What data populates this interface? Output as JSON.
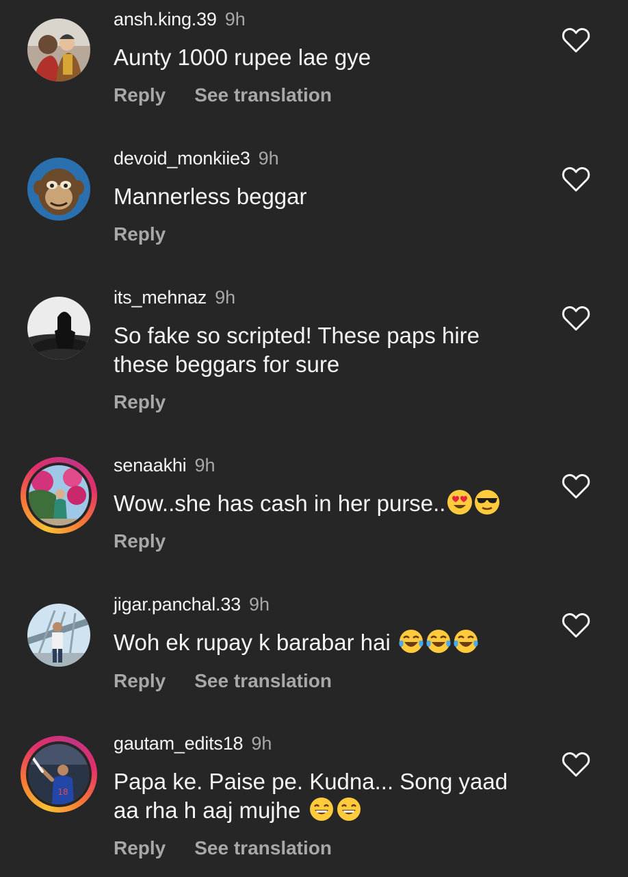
{
  "comments": [
    {
      "username": "ansh.king.39",
      "time": "9h",
      "text": "Aunty 1000 rupee lae gye",
      "reply_label": "Reply",
      "translate_label": "See translation",
      "avatar_icon": "profile-photo-icon",
      "emojis": []
    },
    {
      "username": "devoid_monkiie3",
      "time": "9h",
      "text": "Mannerless beggar",
      "reply_label": "Reply",
      "avatar_icon": "monkey-avatar-icon",
      "emojis": []
    },
    {
      "username": "its_mehnaz",
      "time": "9h",
      "text": "So fake so scripted! These paps hire these beggars for sure",
      "reply_label": "Reply",
      "avatar_icon": "profile-photo-icon",
      "emojis": []
    },
    {
      "username": "senaakhi",
      "time": "9h",
      "text": "Wow..she has cash in her purse..",
      "reply_label": "Reply",
      "avatar_icon": "profile-photo-icon",
      "emojis": [
        "heart-eyes-emoji",
        "sunglasses-emoji"
      ]
    },
    {
      "username": "jigar.panchal.33",
      "time": "9h",
      "text": "Woh ek rupay k barabar hai",
      "reply_label": "Reply",
      "translate_label": "See translation",
      "avatar_icon": "profile-photo-icon",
      "emojis": [
        "tears-of-joy-emoji",
        "tears-of-joy-emoji",
        "tears-of-joy-emoji"
      ]
    },
    {
      "username": "gautam_edits18",
      "time": "9h",
      "text": "Papa ke. Paise pe. Kudna... Song yaad aa rha h aaj mujhe",
      "reply_label": "Reply",
      "translate_label": "See translation",
      "avatar_icon": "profile-photo-icon",
      "emojis": [
        "grinning-emoji",
        "grinning-emoji"
      ]
    }
  ],
  "colors": {
    "background": "#262626",
    "primary_text": "#f5f5f5",
    "secondary_text": "#a8a8a8",
    "story_ring": "#e1306c"
  }
}
